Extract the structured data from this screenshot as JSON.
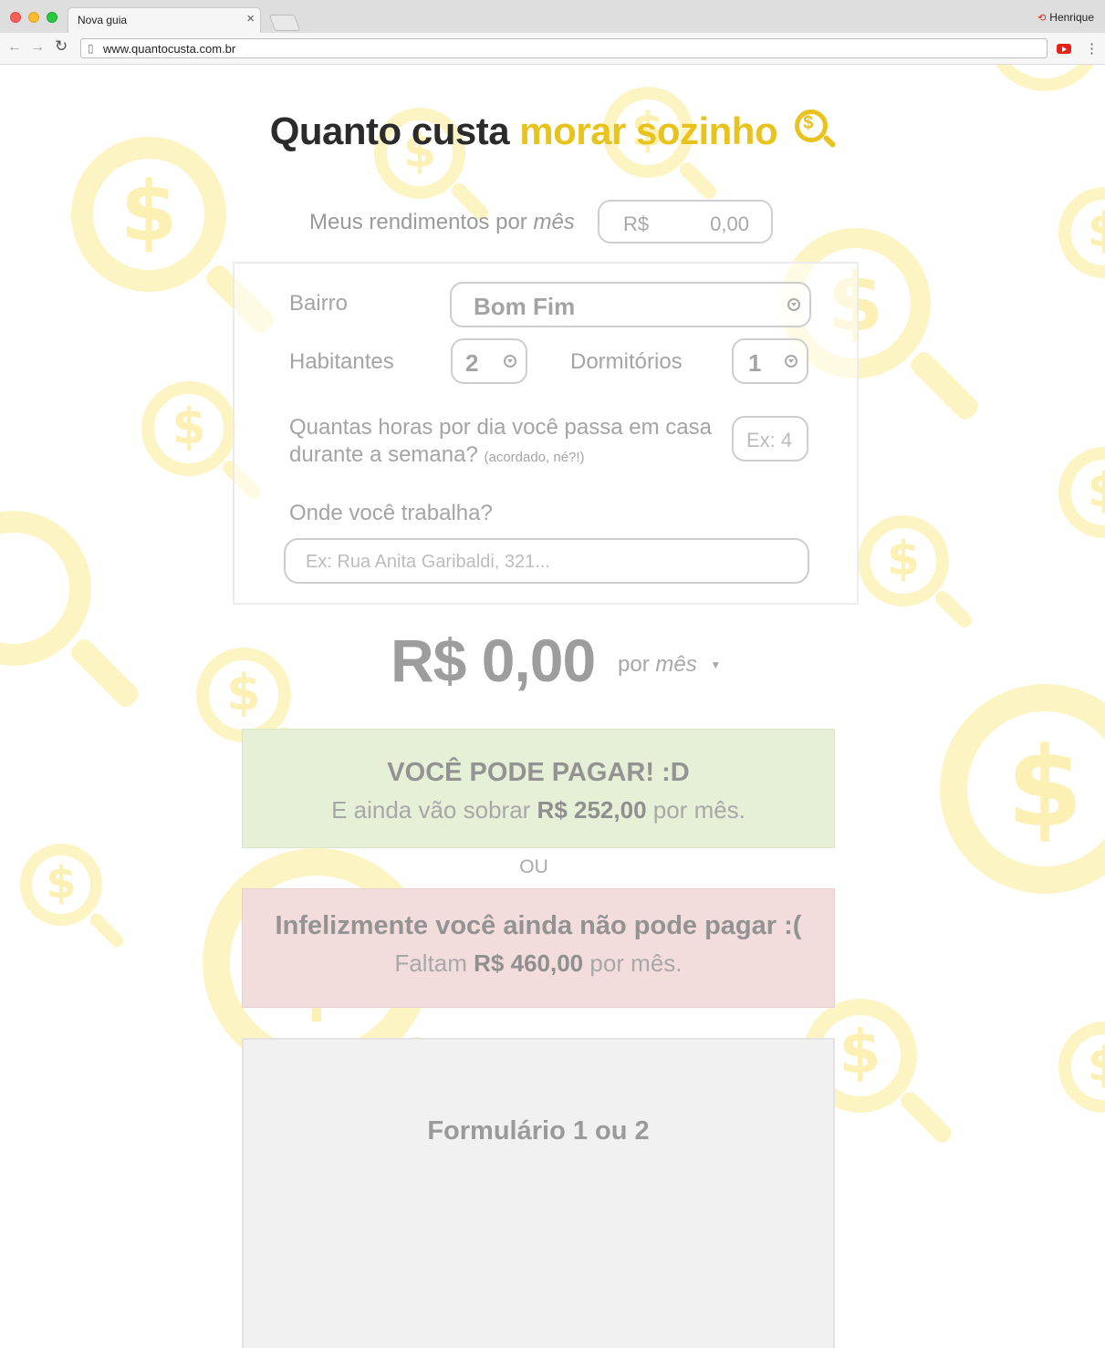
{
  "browser": {
    "tab_title": "Nova guia",
    "tab_close": "×",
    "profile_name": "Henrique",
    "url": "www.quantocusta.com.br",
    "icons": [
      "back-icon",
      "forward-icon",
      "reload-icon",
      "page-icon",
      "youtube-extension-icon",
      "menu-icon"
    ]
  },
  "header": {
    "title_main": "Quanto custa",
    "title_accent": "morar sozinho",
    "icon": "dollar-magnifier-icon",
    "accent_color": "#e8c31d"
  },
  "income": {
    "label_prefix": "Meus rendimentos por",
    "label_emphasis": "mês",
    "currency": "R$",
    "value": "0,00"
  },
  "form": {
    "neighborhood_label": "Bairro",
    "neighborhood_value": "Bom Fim",
    "inhabitants_label": "Habitantes",
    "inhabitants_value": "2",
    "bedrooms_label": "Dormitórios",
    "bedrooms_value": "1",
    "hours_question": "Quantas horas por dia você passa em casa durante a semana?",
    "hours_note": "(acordado, né?!)",
    "hours_placeholder": "Ex: 4",
    "work_label": "Onde você trabalha?",
    "work_placeholder": "Ex: Rua Anita Garibaldi, 321..."
  },
  "result": {
    "total": "R$ 0,00",
    "period_prefix": "por",
    "period_emphasis": "mês",
    "period_arrow": "▼"
  },
  "affordable": {
    "heading": "VOCÊ PODE PAGAR! :D",
    "text_before": "E ainda vão sobrar",
    "amount": "R$ 252,00",
    "text_after": "por mês.",
    "color": "#e5f0d7"
  },
  "separator": "OU",
  "not_affordable": {
    "heading": "Infelizmente você ainda não pode pagar :(",
    "text_before": "Faltam",
    "amount": "R$ 460,00",
    "text_after": "por mês.",
    "color": "#f2dcdc"
  },
  "form_placeholder": {
    "title": "Formulário 1 ou 2"
  }
}
